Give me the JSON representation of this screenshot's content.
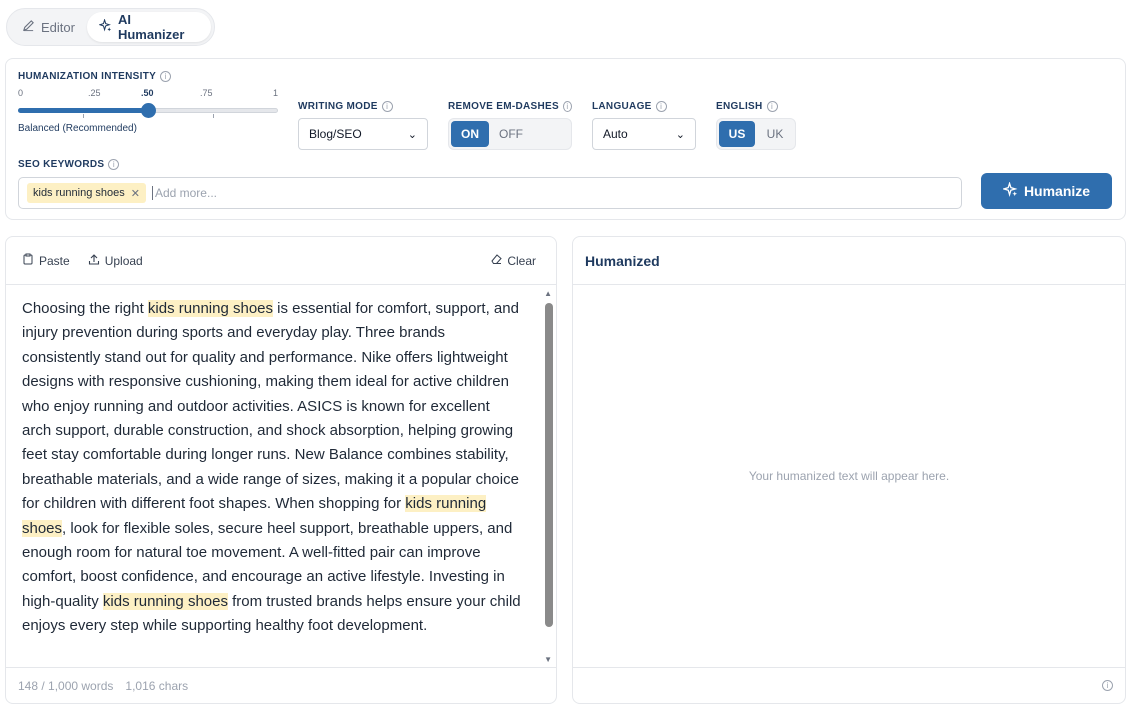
{
  "tabs": [
    {
      "label": "Editor",
      "icon": "pencil-icon"
    },
    {
      "label": "AI Humanizer",
      "icon": "sparkle-icon"
    }
  ],
  "settings": {
    "intensity": {
      "label": "HUMANIZATION INTENSITY",
      "ticks": [
        "0",
        ".25",
        ".50",
        ".75",
        "1"
      ],
      "value": 0.5,
      "caption": "Balanced (Recommended)"
    },
    "writing_mode": {
      "label": "WRITING MODE",
      "value": "Blog/SEO"
    },
    "em_dashes": {
      "label": "REMOVE EM-DASHES",
      "on": "ON",
      "off": "OFF",
      "selected": "ON"
    },
    "language": {
      "label": "LANGUAGE",
      "value": "Auto"
    },
    "english": {
      "label": "ENGLISH",
      "us": "US",
      "uk": "UK",
      "selected": "US"
    },
    "seo": {
      "label": "SEO KEYWORDS",
      "keywords": [
        "kids running shoes"
      ],
      "placeholder": "Add more..."
    },
    "humanize_label": "Humanize"
  },
  "input_panel": {
    "paste_label": "Paste",
    "upload_label": "Upload",
    "clear_label": "Clear",
    "text_segments": [
      {
        "text": "Choosing the right ",
        "hl": false
      },
      {
        "text": "kids running shoes",
        "hl": true
      },
      {
        "text": " is essential for comfort, support, and injury prevention during sports and everyday play. Three brands consistently stand out for quality and performance. Nike offers lightweight designs with responsive cushioning, making them ideal for active children who enjoy running and outdoor activities. ASICS is known for excellent arch support, durable construction, and shock absorption, helping growing feet stay comfortable during longer runs. New Balance combines stability, breathable materials, and a wide range of sizes, making it a popular choice for children with different foot shapes. When shopping for ",
        "hl": false
      },
      {
        "text": "kids running shoes",
        "hl": true
      },
      {
        "text": ", look for flexible soles, secure heel support, breathable uppers, and enough room for natural toe movement. A well-fitted pair can improve comfort, boost confidence, and encourage an active lifestyle. Investing in high-quality ",
        "hl": false
      },
      {
        "text": "kids running shoes",
        "hl": true
      },
      {
        "text": " from trusted brands helps ensure your child enjoys every step while supporting healthy foot development.",
        "hl": false
      }
    ],
    "word_count": "148 / 1,000 words",
    "char_count": "1,016 chars"
  },
  "output_panel": {
    "title": "Humanized",
    "placeholder": "Your humanized text will appear here."
  }
}
